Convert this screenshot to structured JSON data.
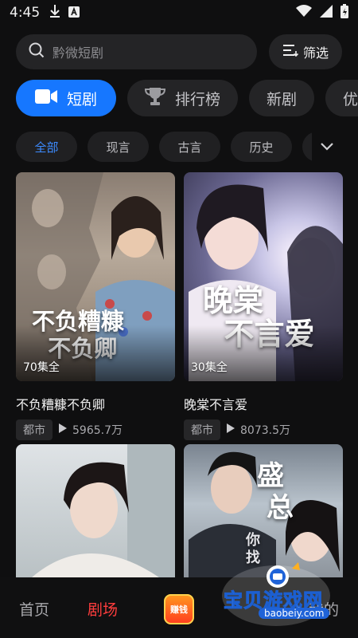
{
  "status_bar": {
    "time": "4:45"
  },
  "search": {
    "placeholder": "黔微短剧"
  },
  "filter": {
    "label": "筛选"
  },
  "categories": [
    {
      "label": "短剧",
      "icon": "video-camera-icon",
      "active": true
    },
    {
      "label": "排行榜",
      "icon": "trophy-icon",
      "active": false
    },
    {
      "label": "新剧",
      "active": false
    },
    {
      "label": "优",
      "active": false
    }
  ],
  "genres": [
    {
      "label": "全部",
      "active": true
    },
    {
      "label": "现言",
      "active": false
    },
    {
      "label": "古言",
      "active": false
    },
    {
      "label": "历史",
      "active": false
    }
  ],
  "dramas": [
    {
      "title": "不负糟糠不负卿",
      "episodes": "70集全",
      "tag": "都市",
      "plays": "5965.7万",
      "poster_text": "不负糟糠\n不负卿"
    },
    {
      "title": "晚棠不言爱",
      "episodes": "30集全",
      "tag": "都市",
      "plays": "8073.5万",
      "poster_text": "晚棠\n不言爱"
    },
    {
      "title": "",
      "episodes": "",
      "tag": "",
      "plays": ""
    },
    {
      "title": "",
      "episodes": "",
      "tag": "",
      "plays": "",
      "poster_text": "盛总 你找错"
    }
  ],
  "bottom_nav": {
    "home": "首页",
    "theater": "剧场",
    "earn": "赚钱",
    "mine": "我的"
  },
  "watermark": {
    "text": "宝贝游戏网",
    "url": "baobeiy.com"
  },
  "colors": {
    "accent": "#1677ff",
    "active_nav": "#ff3d3d",
    "background": "#0f0f10"
  }
}
